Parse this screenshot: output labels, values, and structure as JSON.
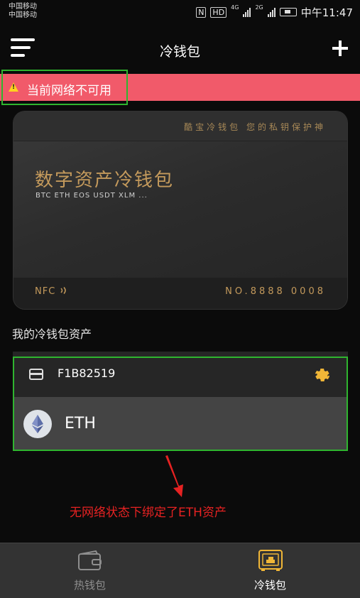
{
  "status_bar": {
    "carrier_1": "中国移动",
    "carrier_2": "中国移动",
    "nfc": "N",
    "hd": "HD",
    "net_1": "4G",
    "net_2": "2G",
    "time": "中午11:47"
  },
  "header": {
    "title": "冷钱包",
    "menu_icon": "hamburger-menu-icon",
    "add_icon": "plus-icon"
  },
  "network_banner": {
    "text": "当前网络不可用",
    "icon": "warning-icon",
    "color": "#f15a6a"
  },
  "card": {
    "slogan": "酷宝冷钱包   您的私钥保护神",
    "title": "数字资产冷钱包",
    "coins": "BTC ETH EOS USDT XLM ...",
    "nfc_label": "NFC",
    "number": "NO.8888 0008",
    "accent": "#c49a5c"
  },
  "assets": {
    "section_label": "我的冷钱包资产",
    "wallet_id": "F1B82519",
    "wallet_icon": "card-icon",
    "settings_icon": "gear-icon",
    "rows": [
      {
        "name": "ETH",
        "icon": "ethereum-icon"
      }
    ]
  },
  "annotation": {
    "text": "无网络状态下绑定了ETH资产",
    "color": "#e62222",
    "box_color": "#2fb52f"
  },
  "tab_bar": {
    "tabs": [
      {
        "label": "热钱包",
        "icon": "wallet-icon",
        "active": false
      },
      {
        "label": "冷钱包",
        "icon": "safe-icon",
        "active": true
      }
    ]
  }
}
